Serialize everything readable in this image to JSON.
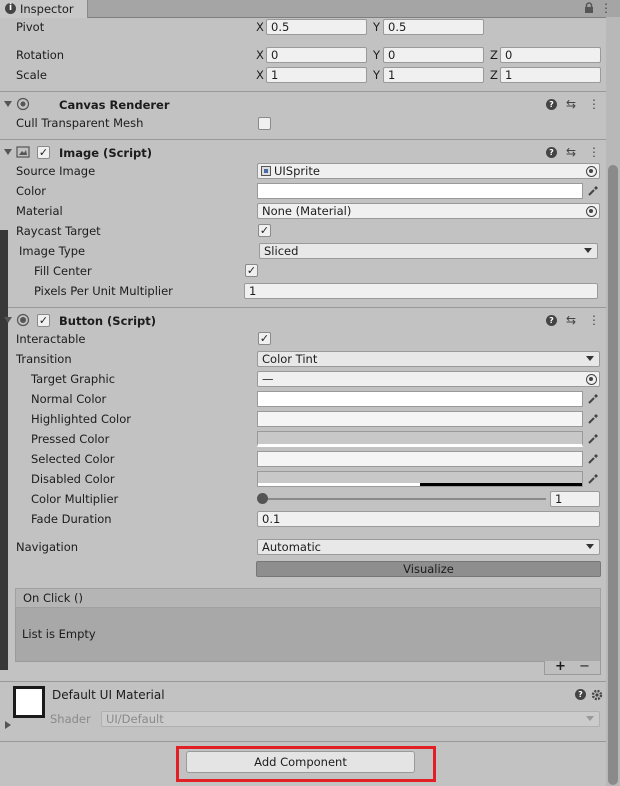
{
  "tab": {
    "title": "Inspector"
  },
  "rect_transform": {
    "pivot": {
      "label": "Pivot",
      "x": "0.5",
      "y": "0.5"
    },
    "rotation": {
      "label": "Rotation",
      "x": "0",
      "y": "0",
      "z": "0"
    },
    "scale": {
      "label": "Scale",
      "x": "1",
      "y": "1",
      "z": "1"
    },
    "axes": {
      "x": "X",
      "y": "Y",
      "z": "Z"
    }
  },
  "canvas_renderer": {
    "title": "Canvas Renderer",
    "cull_label": "Cull Transparent Mesh",
    "cull_checked": false
  },
  "image": {
    "title": "Image (Script)",
    "enabled": true,
    "source_image_label": "Source Image",
    "source_image_value": "UISprite",
    "color_label": "Color",
    "material_label": "Material",
    "material_value": "None (Material)",
    "raycast_label": "Raycast Target",
    "raycast_checked": true,
    "image_type_label": "Image Type",
    "image_type_value": "Sliced",
    "fill_center_label": "Fill Center",
    "fill_center_checked": true,
    "ppu_label": "Pixels Per Unit Multiplier",
    "ppu_value": "1"
  },
  "button": {
    "title": "Button (Script)",
    "enabled": true,
    "interactable_label": "Interactable",
    "interactable_checked": true,
    "transition_label": "Transition",
    "transition_value": "Color Tint",
    "target_graphic_label": "Target Graphic",
    "target_graphic_value": "—",
    "normal_color_label": "Normal Color",
    "highlighted_color_label": "Highlighted Color",
    "pressed_color_label": "Pressed Color",
    "selected_color_label": "Selected Color",
    "disabled_color_label": "Disabled Color",
    "colors": {
      "normal": "#ffffff",
      "highlighted": "#f5f5f5",
      "pressed": "#c8c8c8",
      "selected": "#f5f5f5",
      "disabled": "#c8c8c8"
    },
    "color_multiplier_label": "Color Multiplier",
    "color_multiplier_value": "1",
    "color_multiplier_fraction": 0.0,
    "fade_duration_label": "Fade Duration",
    "fade_duration_value": "0.1",
    "navigation_label": "Navigation",
    "navigation_value": "Automatic",
    "visualize_label": "Visualize",
    "on_click_label": "On Click ()",
    "list_empty_label": "List is Empty",
    "plus_label": "+",
    "minus_label": "−"
  },
  "material": {
    "title": "Default UI Material",
    "shader_label": "Shader",
    "shader_value": "UI/Default"
  },
  "add_component": {
    "label": "Add Component"
  },
  "icons": {
    "info": "info-icon",
    "lock": "lock-icon",
    "menu": "kebab-menu-icon",
    "help": "help-icon",
    "presets": "sliders-icon",
    "eyedropper": "eyedropper-icon",
    "object_picker": "object-picker-icon"
  },
  "accent": {
    "highlight": "#e31f26"
  }
}
